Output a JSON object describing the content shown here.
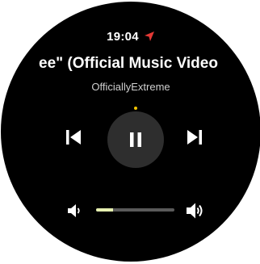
{
  "status_bar": {
    "time": "19:04",
    "location_icon": "navigation-arrow-icon"
  },
  "media": {
    "title": "ee\" (Official Music Video",
    "artist": "OfficiallyExtreme"
  },
  "controls": {
    "previous_icon": "skip-previous-icon",
    "play_pause_icon": "pause-icon",
    "next_icon": "skip-next-icon"
  },
  "volume": {
    "down_icon": "volume-down-icon",
    "up_icon": "volume-up-icon",
    "level": 0.22
  },
  "colors": {
    "background": "#000000",
    "accent_dot": "#f2c400",
    "nav_arrow": "#e53935",
    "volume_fill": "#e6f0b0",
    "button_bg": "#2e2e2e"
  }
}
